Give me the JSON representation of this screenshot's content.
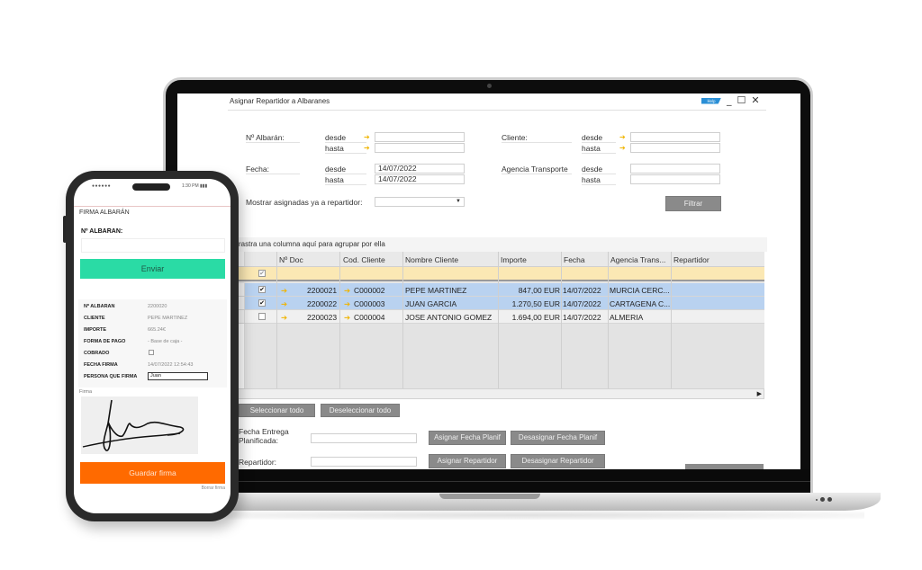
{
  "window": {
    "title": "Asignar Repartidor a Albaranes",
    "help_badge": "Help",
    "minimize": "_",
    "maximize": "☐",
    "close": "✕"
  },
  "filters": {
    "albaran_label": "Nº Albarán:",
    "fecha_label": "Fecha:",
    "cliente_label": "Cliente:",
    "agencia_label": "Agencia Transporte",
    "desde": "desde",
    "hasta": "hasta",
    "albaran_desde": "",
    "albaran_hasta": "",
    "fecha_desde": "14/07/2022",
    "fecha_hasta": "14/07/2022",
    "cliente_desde": "",
    "cliente_hasta": "",
    "agencia_desde": "",
    "agencia_hasta": "",
    "mostrar_label": "Mostrar asignadas ya a repartidor:",
    "mostrar_value": "",
    "filtrar_button": "Filtrar",
    "link_arrow": "➔"
  },
  "grid": {
    "group_hint": "Arrastra una columna aquí para agrupar por ella",
    "columns": [
      "Nº Doc",
      "Cod. Cliente",
      "Nombre Cliente",
      "Importe",
      "Fecha",
      "Agencia Trans...",
      "Repartidor"
    ],
    "rows": [
      {
        "checked": true,
        "selected": true,
        "doc": "2200021",
        "cod": "C000002",
        "nombre": "PEPE MARTINEZ",
        "importe": "847,00 EUR",
        "fecha": "14/07/2022",
        "agencia": "MURCIA CERC...",
        "repartidor": ""
      },
      {
        "checked": true,
        "selected": true,
        "doc": "2200022",
        "cod": "C000003",
        "nombre": "JUAN GARCIA",
        "importe": "1.270,50 EUR",
        "fecha": "14/07/2022",
        "agencia": "CARTAGENA C...",
        "repartidor": ""
      },
      {
        "checked": false,
        "selected": false,
        "doc": "2200023",
        "cod": "C000004",
        "nombre": "JOSE ANTONIO GOMEZ",
        "importe": "1.694,00 EUR",
        "fecha": "14/07/2022",
        "agencia": "ALMERIA",
        "repartidor": ""
      }
    ],
    "check_mark": "✔"
  },
  "actions": {
    "seleccionar_todo": "Seleccionar todo",
    "deseleccionar_todo": "Deseleccionar todo",
    "fecha_entrega_label": "Fecha Entrega Planificada:",
    "fecha_entrega_value": "",
    "asignar_fecha": "Asignar Fecha Planif",
    "desasignar_fecha": "Desasignar Fecha Planif",
    "repartidor_label": "Repartidor:",
    "repartidor_value": "",
    "asignar_repartidor": "Asignar Repartidor",
    "desasignar_repartidor": "Desasignar Repartidor"
  },
  "phone": {
    "status_left": "●●●●●●",
    "status_right": "1:30 PM ▮▮▮",
    "title": "FIRMA ALBARÁN",
    "albaran_label": "Nº ALBARAN:",
    "albaran_value": "",
    "enviar_button": "Enviar",
    "info": [
      {
        "key": "Nº ALBARAN",
        "value": "2200020"
      },
      {
        "key": "CLIENTE",
        "value": "PEPE MARTINEZ"
      },
      {
        "key": "IMPORTE",
        "value": "665.24€"
      },
      {
        "key": "FORMA DE PAGO",
        "value": "- Base de caja -"
      },
      {
        "key": "COBRADO",
        "value": ""
      },
      {
        "key": "FECHA FIRMA",
        "value": "14/07/2022 12:54:43"
      },
      {
        "key": "PERSONA QUE FIRMA",
        "value": "Juan"
      }
    ],
    "firma_label": "Firma",
    "guardar_button": "Guardar firma",
    "borrar_link": "Borrar firma"
  }
}
